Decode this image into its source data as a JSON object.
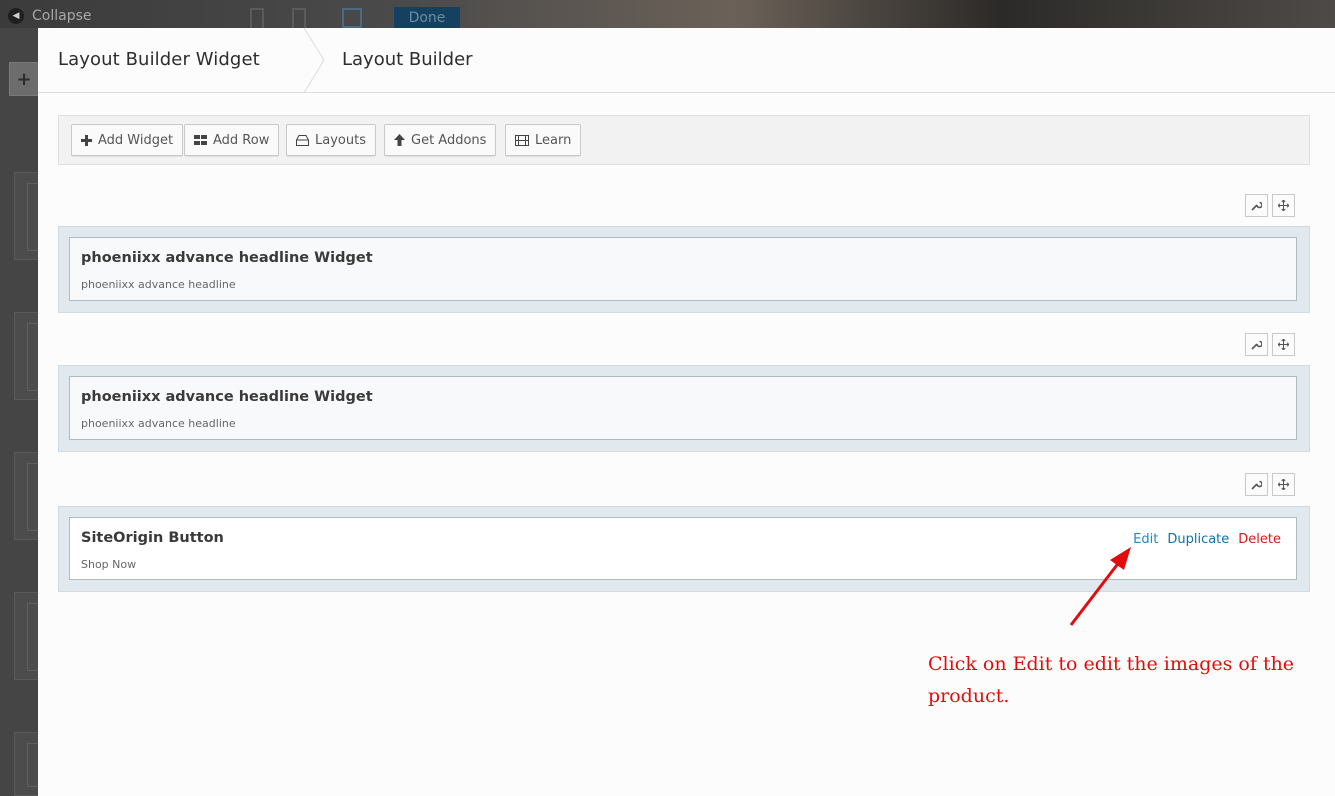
{
  "background": {
    "collapse_label": "Collapse",
    "done_label": "Done",
    "add_icon": "plus-icon"
  },
  "header": {
    "crumb_widget": "Layout Builder Widget",
    "crumb_builder": "Layout Builder"
  },
  "toolbar": {
    "buttons": [
      {
        "label": "Add Widget",
        "icon": "plus-icon"
      },
      {
        "label": "Add Row",
        "icon": "grid-icon"
      },
      {
        "label": "Layouts",
        "icon": "layouts-icon"
      },
      {
        "label": "Get Addons",
        "icon": "arrow-up-icon"
      },
      {
        "label": "Learn",
        "icon": "film-icon"
      }
    ]
  },
  "rows": [
    {
      "title": "phoeniixx advance headline Widget",
      "description": "phoeniixx advance headline"
    },
    {
      "title": "phoeniixx advance headline Widget",
      "description": "phoeniixx advance headline"
    },
    {
      "title": "SiteOrigin Button",
      "description": "Shop Now",
      "actions": {
        "edit": "Edit",
        "duplicate": "Duplicate",
        "delete": "Delete"
      }
    }
  ],
  "annotation": {
    "line1": "Click on Edit to edit the images of the",
    "line2": "product.",
    "color": "#e10d0d"
  },
  "colors": {
    "edit_link": "#1d8ac3",
    "duplicate_link": "#0d73aa",
    "delete_link": "#d41a1a",
    "row_background": "#e2e9ee"
  }
}
